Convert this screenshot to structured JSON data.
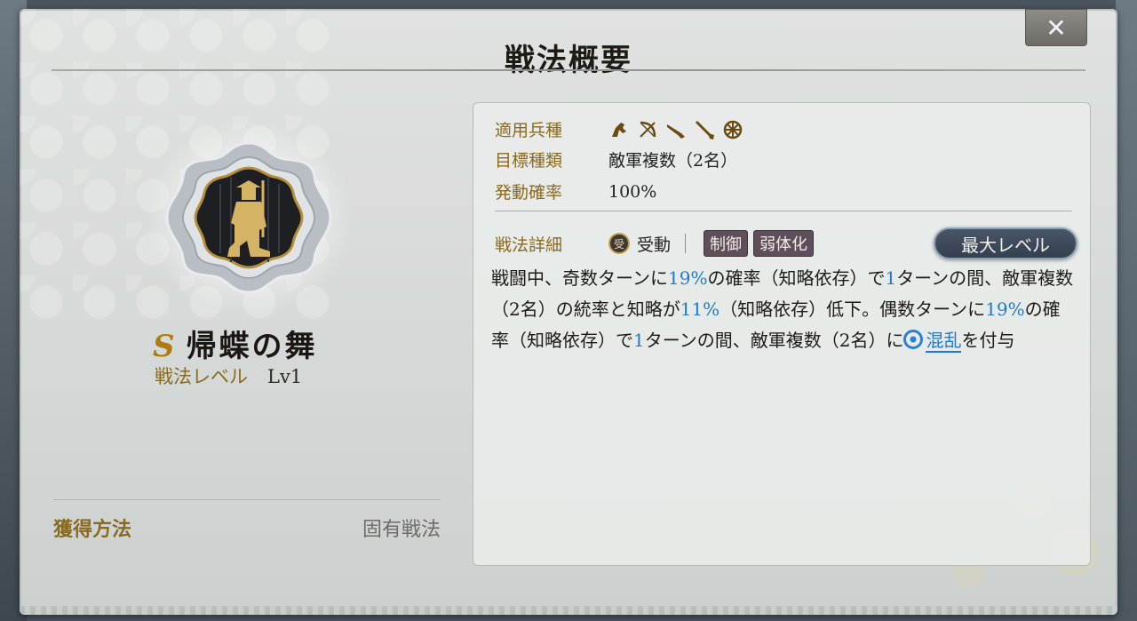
{
  "dialog": {
    "title": "戦法概要",
    "close_label": "✕"
  },
  "tactic": {
    "grade": "S",
    "name": "帰蝶の舞",
    "level_label": "戦法レベル",
    "level_value": "Lv1",
    "emblem_icon": "kneeling-samurai-icon"
  },
  "acquisition": {
    "label": "獲得方法",
    "value": "固有戦法"
  },
  "details": {
    "unit_types_label": "適用兵種",
    "unit_type_icons": [
      "cavalry-icon",
      "archer-bow-icon",
      "gun-icon",
      "spear-icon",
      "siege-wheel-icon"
    ],
    "target_label": "目標種類",
    "target_value": "敵軍複数（2名）",
    "chance_label": "発動確率",
    "chance_value": "100%",
    "detail_label": "戦法詳細",
    "passive_icon_glyph": "受",
    "passive_label": "受動",
    "tags": [
      "制御",
      "弱体化"
    ],
    "max_level_button": "最大レベル"
  },
  "description": {
    "p1": "戦闘中、奇数ターンに",
    "v1": "19%",
    "p2": "の確率（知略依存）で",
    "v2": "1",
    "p3": "ターンの間、敵軍複数（2名）の統率と知略が",
    "v3": "11%",
    "p4": "（知略依存）低下。偶数ターンに",
    "v4": "19%",
    "p5": "の確率（知略依存）で",
    "v5": "1",
    "p6": "ターンの間、敵軍複数（2名）に",
    "status": "混乱",
    "p7": "を付与"
  },
  "colors": {
    "accent_gold": "#8a6a1e",
    "highlight_blue": "#1f78d1",
    "tag_bg": "#5e4f5a"
  }
}
